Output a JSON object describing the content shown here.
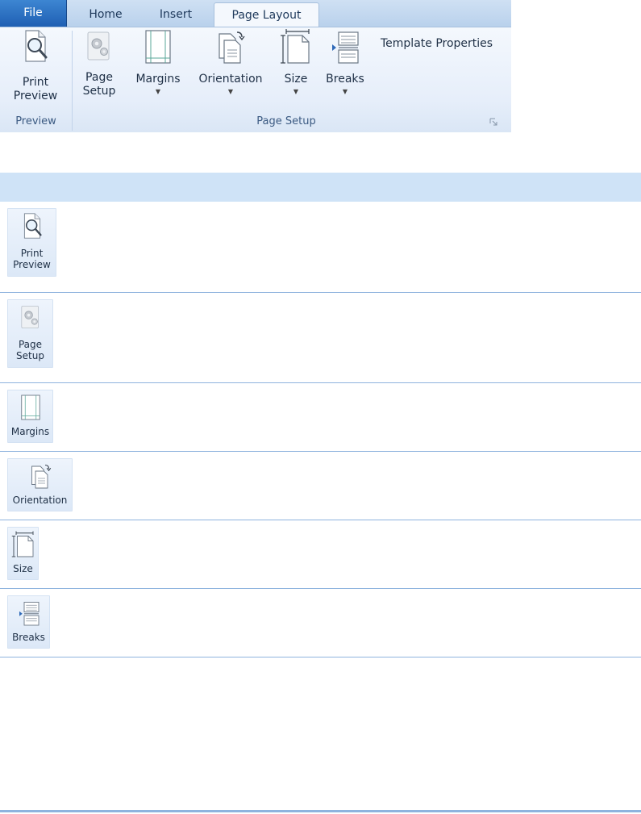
{
  "ribbon": {
    "tabs": [
      {
        "label": "File"
      },
      {
        "label": "Home"
      },
      {
        "label": "Insert"
      },
      {
        "label": "Page Layout"
      }
    ],
    "groups": {
      "preview": {
        "label": "Preview",
        "print_preview": {
          "line1": "Print",
          "line2": "Preview",
          "icon": "print-preview-icon"
        }
      },
      "page_setup": {
        "label": "Page Setup",
        "page_setup_btn": {
          "line1": "Page",
          "line2": "Setup",
          "icon": "page-setup-icon"
        },
        "margins": {
          "label": "Margins",
          "icon": "margins-icon"
        },
        "orientation": {
          "label": "Orientation",
          "icon": "orientation-icon"
        },
        "size": {
          "label": "Size",
          "icon": "size-icon"
        },
        "breaks": {
          "label": "Breaks",
          "icon": "breaks-icon"
        },
        "template_properties": {
          "label": "Template Properties"
        }
      }
    }
  },
  "table": {
    "rows": [
      {
        "line1": "Print",
        "line2": "Preview",
        "icon": "print-preview-icon"
      },
      {
        "line1": "Page",
        "line2": "Setup",
        "icon": "page-setup-icon"
      },
      {
        "line1": "Margins",
        "icon": "margins-icon"
      },
      {
        "line1": "Orientation",
        "icon": "orientation-icon"
      },
      {
        "line1": "Size",
        "icon": "size-icon"
      },
      {
        "line1": "Breaks",
        "icon": "breaks-icon"
      }
    ]
  },
  "colors": {
    "accent": "#1f5fb3",
    "ribbon_tabbar": "#c5d9f0",
    "table_header": "#cfe3f7",
    "row_border": "#8eb3de"
  }
}
